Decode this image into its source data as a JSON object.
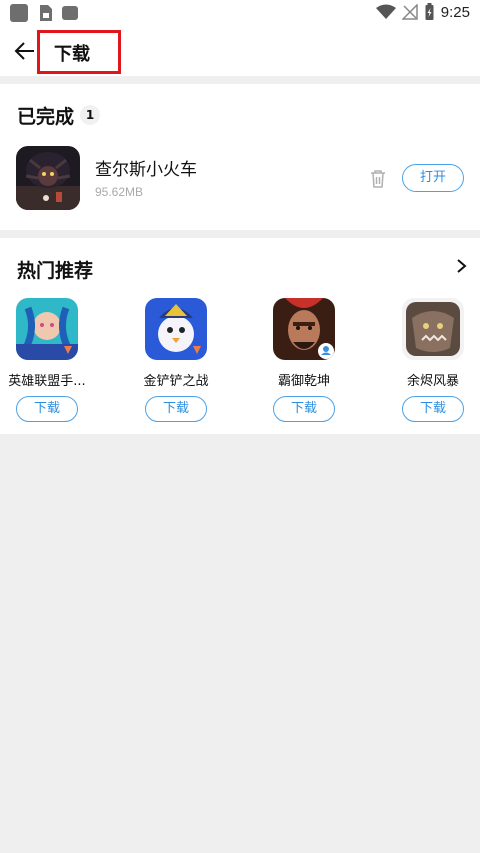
{
  "status_bar": {
    "time": "9:25"
  },
  "header": {
    "title": "下载"
  },
  "completed": {
    "title": "已完成",
    "count": "1",
    "item": {
      "name": "查尔斯小火车",
      "size": "95.62MB",
      "open_label": "打开"
    }
  },
  "hot": {
    "title": "热门推荐",
    "items": [
      {
        "name": "英雄联盟手...",
        "button": "下载"
      },
      {
        "name": "金铲铲之战",
        "button": "下载"
      },
      {
        "name": "霸御乾坤",
        "button": "下载"
      },
      {
        "name": "余烬风暴",
        "button": "下载"
      }
    ]
  },
  "colors": {
    "accent": "#2d8ee0",
    "highlight_box": "#e0161d"
  }
}
